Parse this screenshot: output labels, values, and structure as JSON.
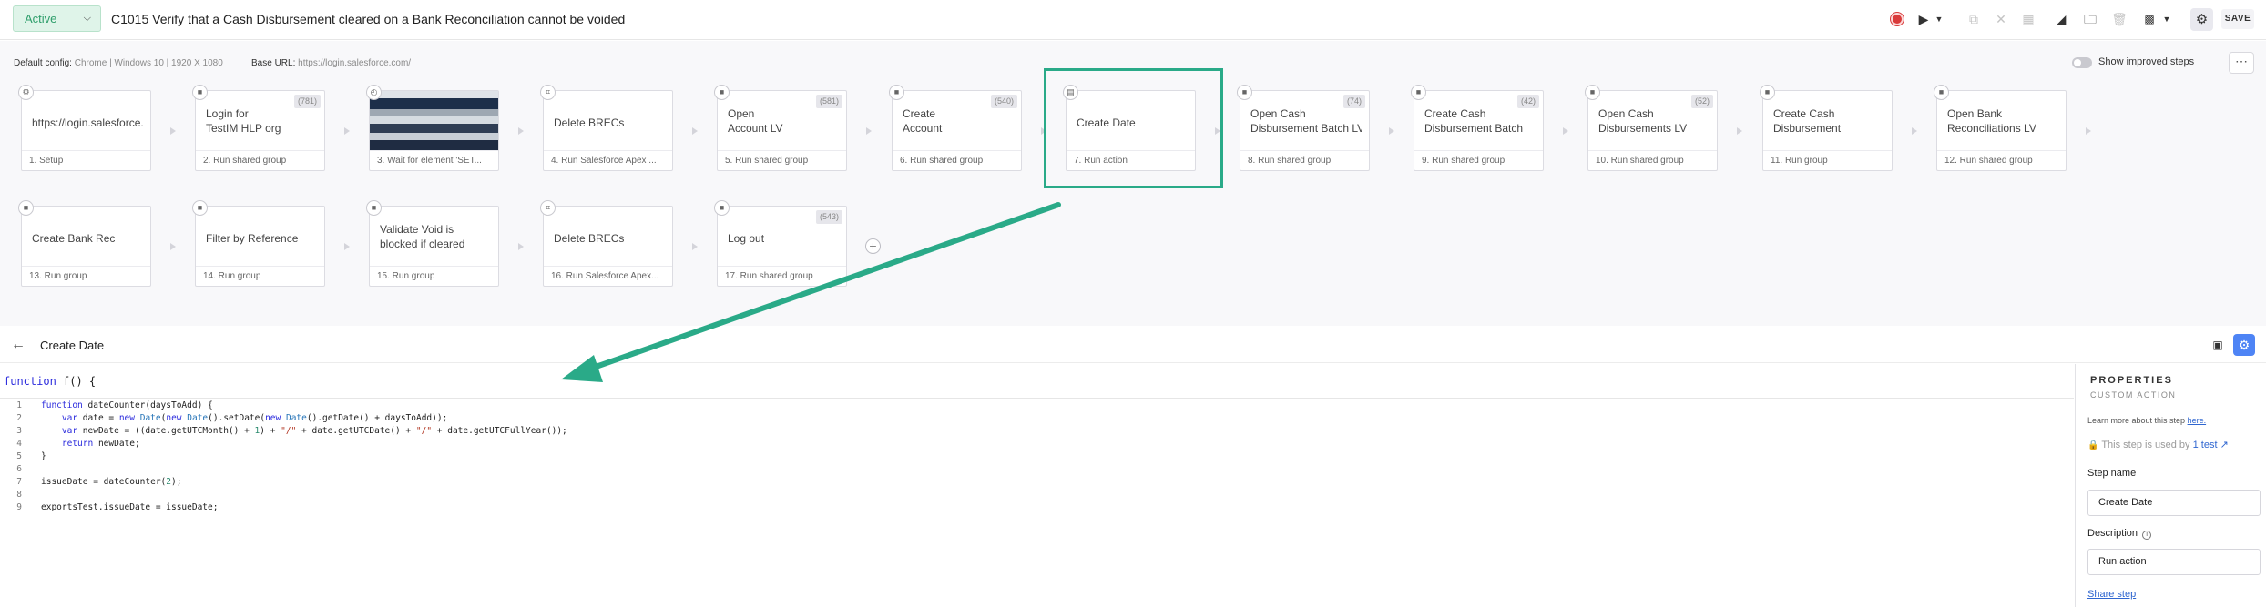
{
  "header": {
    "status": "Active",
    "title": "C1015 Verify that a Cash Disbursement cleared on a Bank Reconciliation cannot be voided",
    "save_label": "SAVE"
  },
  "config": {
    "default_config_label": "Default config:",
    "default_config_value": "Chrome | Windows 10 | 1920 X 1080",
    "base_url_label": "Base URL:",
    "base_url_value": "https://login.salesforce.com/",
    "improved_steps_label": "Show improved steps"
  },
  "steps": [
    {
      "name": "https://login.salesforce.",
      "sub": "1. Setup",
      "badge": "",
      "icon": "gear-icon"
    },
    {
      "name": "Login for\nTestIM HLP org",
      "sub": "2. Run shared group",
      "badge": "(781)",
      "icon": "folder-icon"
    },
    {
      "name": "",
      "sub": "3. Wait for element 'SET...",
      "badge": "",
      "icon": "clock-icon"
    },
    {
      "name": "Delete BRECs",
      "sub": "4. Run Salesforce Apex ...",
      "badge": "",
      "icon": "code-icon"
    },
    {
      "name": "Open\nAccount LV",
      "sub": "5. Run shared group",
      "badge": "(581)",
      "icon": "folder-icon"
    },
    {
      "name": "Create\nAccount",
      "sub": "6. Run shared group",
      "badge": "(540)",
      "icon": "folder-icon"
    },
    {
      "name": "Create Date",
      "sub": "7. Run action",
      "badge": "",
      "icon": "script-icon"
    },
    {
      "name": "Open Cash\nDisbursement Batch LV",
      "sub": "8. Run shared group",
      "badge": "(74)",
      "icon": "folder-icon"
    },
    {
      "name": "Create Cash\nDisbursement Batch",
      "sub": "9. Run shared group",
      "badge": "(42)",
      "icon": "folder-icon"
    },
    {
      "name": "Open Cash\nDisbursements LV",
      "sub": "10. Run shared group",
      "badge": "(52)",
      "icon": "folder-icon"
    },
    {
      "name": "Create Cash\nDisbursement",
      "sub": "11. Run group",
      "badge": "",
      "icon": "folder-icon"
    },
    {
      "name": "Open Bank\nReconciliations LV",
      "sub": "12. Run shared group",
      "badge": "",
      "icon": "folder-icon"
    },
    {
      "name": "Create Bank Rec",
      "sub": "13. Run group",
      "badge": "",
      "icon": "folder-icon"
    },
    {
      "name": "Filter by Reference",
      "sub": "14. Run group",
      "badge": "",
      "icon": "folder-icon"
    },
    {
      "name": "Validate Void is\nblocked if cleared",
      "sub": "15. Run group",
      "badge": "",
      "icon": "folder-icon"
    },
    {
      "name": "Delete BRECs",
      "sub": "16. Run Salesforce Apex...",
      "badge": "",
      "icon": "code-icon"
    },
    {
      "name": "Log out",
      "sub": "17. Run shared group",
      "badge": "(543)",
      "icon": "folder-icon"
    }
  ],
  "editor": {
    "title": "Create Date",
    "signature_kw": "function",
    "signature_rest": " f() {",
    "line_numbers": [
      "1",
      "2",
      "3",
      "4",
      "5",
      "6",
      "7",
      "8",
      "9"
    ]
  },
  "properties": {
    "title": "PROPERTIES",
    "subtitle": "CUSTOM ACTION",
    "learn_text": "Learn more about this step ",
    "learn_link": "here.",
    "used_text": "This step is used by ",
    "used_link": "1 test",
    "step_name_label": "Step name",
    "step_name_value": "Create Date",
    "description_label": "Description",
    "description_value": "Run action",
    "share_label": "Share step"
  },
  "colors": {
    "accent": "#2aaa88",
    "active_badge": "#dff4e9",
    "link": "#2f66d0",
    "record": "#d93a3a"
  }
}
